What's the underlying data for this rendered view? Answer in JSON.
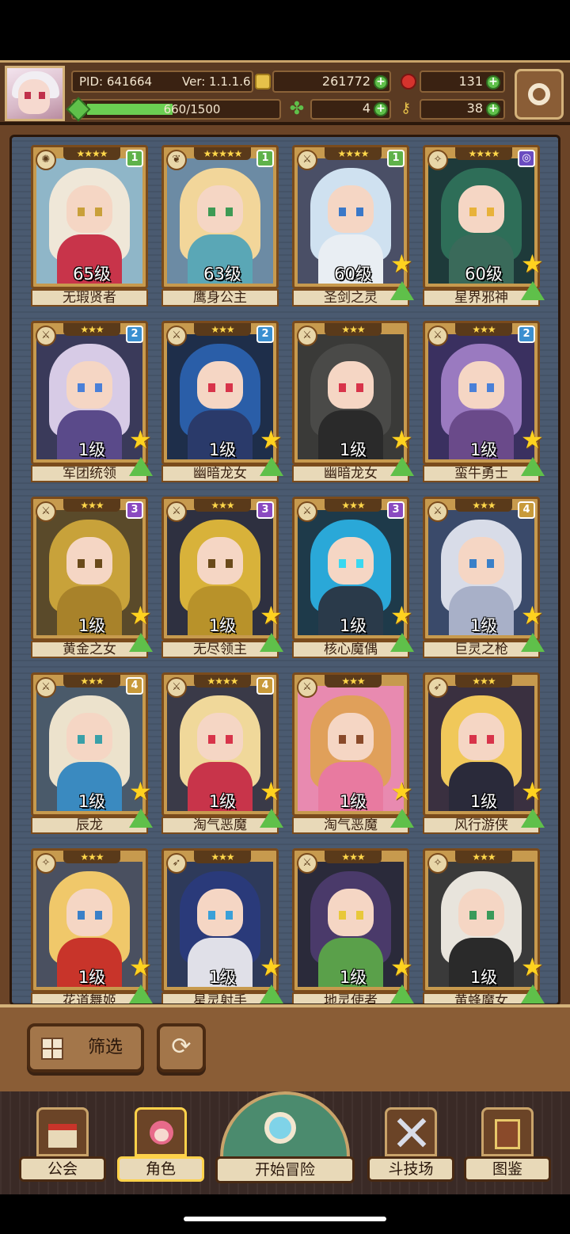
{
  "header": {
    "pid": "PID: 641664",
    "version": "Ver: 1.1.1.6",
    "gold": "261772",
    "ruby": "131",
    "exp_text": "660/1500",
    "exp_fraction": 0.44,
    "clover": "4",
    "key": "38"
  },
  "cards": [
    {
      "name": "无瑕贤者",
      "level": "65级",
      "stars": "★★★★",
      "badge": "1",
      "badge_color": "#5fb24a",
      "type": "sun-icon",
      "hair": "#efe7d8",
      "body": "#c8344a",
      "eye": "#c9a03a",
      "bg": "#8fb6c8",
      "show_star": false
    },
    {
      "name": "鹰身公主",
      "level": "63级",
      "stars": "★★★★★",
      "badge": "1",
      "badge_color": "#5fb24a",
      "type": "wing-icon",
      "hair": "#f2d69a",
      "body": "#5aa7b6",
      "eye": "#3e9a54",
      "bg": "#6c8ba4",
      "show_star": false
    },
    {
      "name": "圣剑之灵",
      "level": "60级",
      "stars": "★★★★",
      "badge": "1",
      "badge_color": "#5fb24a",
      "type": "sword-icon",
      "hair": "#cfe1f0",
      "body": "#e9eef3",
      "eye": "#3a78c8",
      "bg": "#4a4f66",
      "show_star": true
    },
    {
      "name": "星界邪神",
      "level": "60级",
      "stars": "★★★★",
      "badge": "◎",
      "badge_color": "#6a4cc0",
      "type": "wand-icon",
      "hair": "#2e6e58",
      "body": "#3a6a5a",
      "eye": "#e8b23a",
      "bg": "#1e3a3a",
      "show_star": true
    },
    {
      "name": "军团统领",
      "level": "1级",
      "stars": "★★★",
      "badge": "2",
      "badge_color": "#3a8fd0",
      "type": "sword-icon",
      "hair": "#d7cbe6",
      "body": "#5a4a8a",
      "eye": "#4a80d8",
      "bg": "#3a3a5a",
      "show_star": true
    },
    {
      "name": "幽暗龙女",
      "level": "1级",
      "stars": "★★★",
      "badge": "2",
      "badge_color": "#3a8fd0",
      "type": "sword-icon",
      "hair": "#2a5ea8",
      "body": "#2a3a6a",
      "eye": "#d8344a",
      "bg": "#1e2e4a",
      "show_star": true
    },
    {
      "name": "幽暗龙女",
      "level": "1级",
      "stars": "★★★",
      "badge": "",
      "badge_color": "#3a8fd0",
      "type": "sword-icon",
      "hair": "#4a4a48",
      "body": "#2a2a2a",
      "eye": "#d8344a",
      "bg": "#3a3a38",
      "show_star": true
    },
    {
      "name": "蛮牛勇士",
      "level": "1级",
      "stars": "★★★",
      "badge": "2",
      "badge_color": "#3a8fd0",
      "type": "sword-icon",
      "hair": "#9a7ac0",
      "body": "#6a4a8a",
      "eye": "#4a80d8",
      "bg": "#3a3060",
      "show_star": true
    },
    {
      "name": "黄金之女",
      "level": "1级",
      "stars": "★★★",
      "badge": "3",
      "badge_color": "#8a4ac0",
      "type": "sword-icon",
      "hair": "#c8a23a",
      "body": "#a8822a",
      "eye": "#6a4a1a",
      "bg": "#5a4a2a",
      "show_star": true
    },
    {
      "name": "无尽领主",
      "level": "1级",
      "stars": "★★★",
      "badge": "3",
      "badge_color": "#8a4ac0",
      "type": "sword-icon",
      "hair": "#d8b23a",
      "body": "#b8922a",
      "eye": "#6a4a1a",
      "bg": "#2e3040",
      "show_star": true
    },
    {
      "name": "核心魔偶",
      "level": "1级",
      "stars": "★★★",
      "badge": "3",
      "badge_color": "#8a4ac0",
      "type": "sword-icon",
      "hair": "#2aa8d8",
      "body": "#2a3a4a",
      "eye": "#3ad8f0",
      "bg": "#1e3a4a",
      "show_star": true
    },
    {
      "name": "巨灵之枪",
      "level": "1级",
      "stars": "★★★",
      "badge": "4",
      "badge_color": "#c89a3a",
      "type": "sword-icon",
      "hair": "#d8dce8",
      "body": "#a8b0c8",
      "eye": "#3a80c8",
      "bg": "#3a4a6a",
      "show_star": true
    },
    {
      "name": "辰龙",
      "level": "1级",
      "stars": "★★★",
      "badge": "4",
      "badge_color": "#c89a3a",
      "type": "sword-icon",
      "hair": "#ece2cc",
      "body": "#3a8ac0",
      "eye": "#3aa0a8",
      "bg": "#4a5a6a",
      "show_star": true
    },
    {
      "name": "淘气恶魔",
      "level": "1级",
      "stars": "★★★★",
      "badge": "4",
      "badge_color": "#c89a3a",
      "type": "sword-icon",
      "hair": "#f0d89a",
      "body": "#c8344a",
      "eye": "#d8344a",
      "bg": "#3a3a48",
      "show_star": true
    },
    {
      "name": "淘气恶魔",
      "level": "1级",
      "stars": "★★★",
      "badge": "",
      "badge_color": "#c89a3a",
      "type": "sword-icon",
      "hair": "#e0a05a",
      "body": "#e87aa0",
      "eye": "#8a4a2a",
      "bg": "#e88ab0",
      "show_star": true
    },
    {
      "name": "风行游侠",
      "level": "1级",
      "stars": "★★★",
      "badge": "",
      "badge_color": "#c89a3a",
      "type": "bow-icon",
      "hair": "#f0c85a",
      "body": "#2a2a3a",
      "eye": "#d8344a",
      "bg": "#3a3040",
      "show_star": true
    },
    {
      "name": "花道舞姬",
      "level": "1级",
      "stars": "★★★",
      "badge": "",
      "badge_color": "#c89a3a",
      "type": "wand-icon",
      "hair": "#f0c86a",
      "body": "#c8342a",
      "eye": "#3a80c8",
      "bg": "#4a5060",
      "show_star": true
    },
    {
      "name": "星灵射手",
      "level": "1级",
      "stars": "★★★",
      "badge": "",
      "badge_color": "#c89a3a",
      "type": "bow-icon",
      "hair": "#2a3a7a",
      "body": "#e0e0e8",
      "eye": "#3aa0d8",
      "bg": "#2e3a5a",
      "show_star": true
    },
    {
      "name": "地灵使者",
      "level": "1级",
      "stars": "★★★",
      "badge": "",
      "badge_color": "#c89a3a",
      "type": "sword-icon",
      "hair": "#4a3a6a",
      "body": "#5aa04a",
      "eye": "#e8c83a",
      "bg": "#2a2a3a",
      "show_star": true
    },
    {
      "name": "黄蜂魔女",
      "level": "1级",
      "stars": "★★★",
      "badge": "",
      "badge_color": "#c89a3a",
      "type": "wand-icon",
      "hair": "#e8e4dc",
      "body": "#2a2a2a",
      "eye": "#3a9a5a",
      "bg": "#3a3a3a",
      "show_star": true
    }
  ],
  "filter_label": "筛选",
  "nav": {
    "guild": "公会",
    "character": "角色",
    "adventure": "开始冒险",
    "arena": "斗技场",
    "codex": "图鉴"
  }
}
